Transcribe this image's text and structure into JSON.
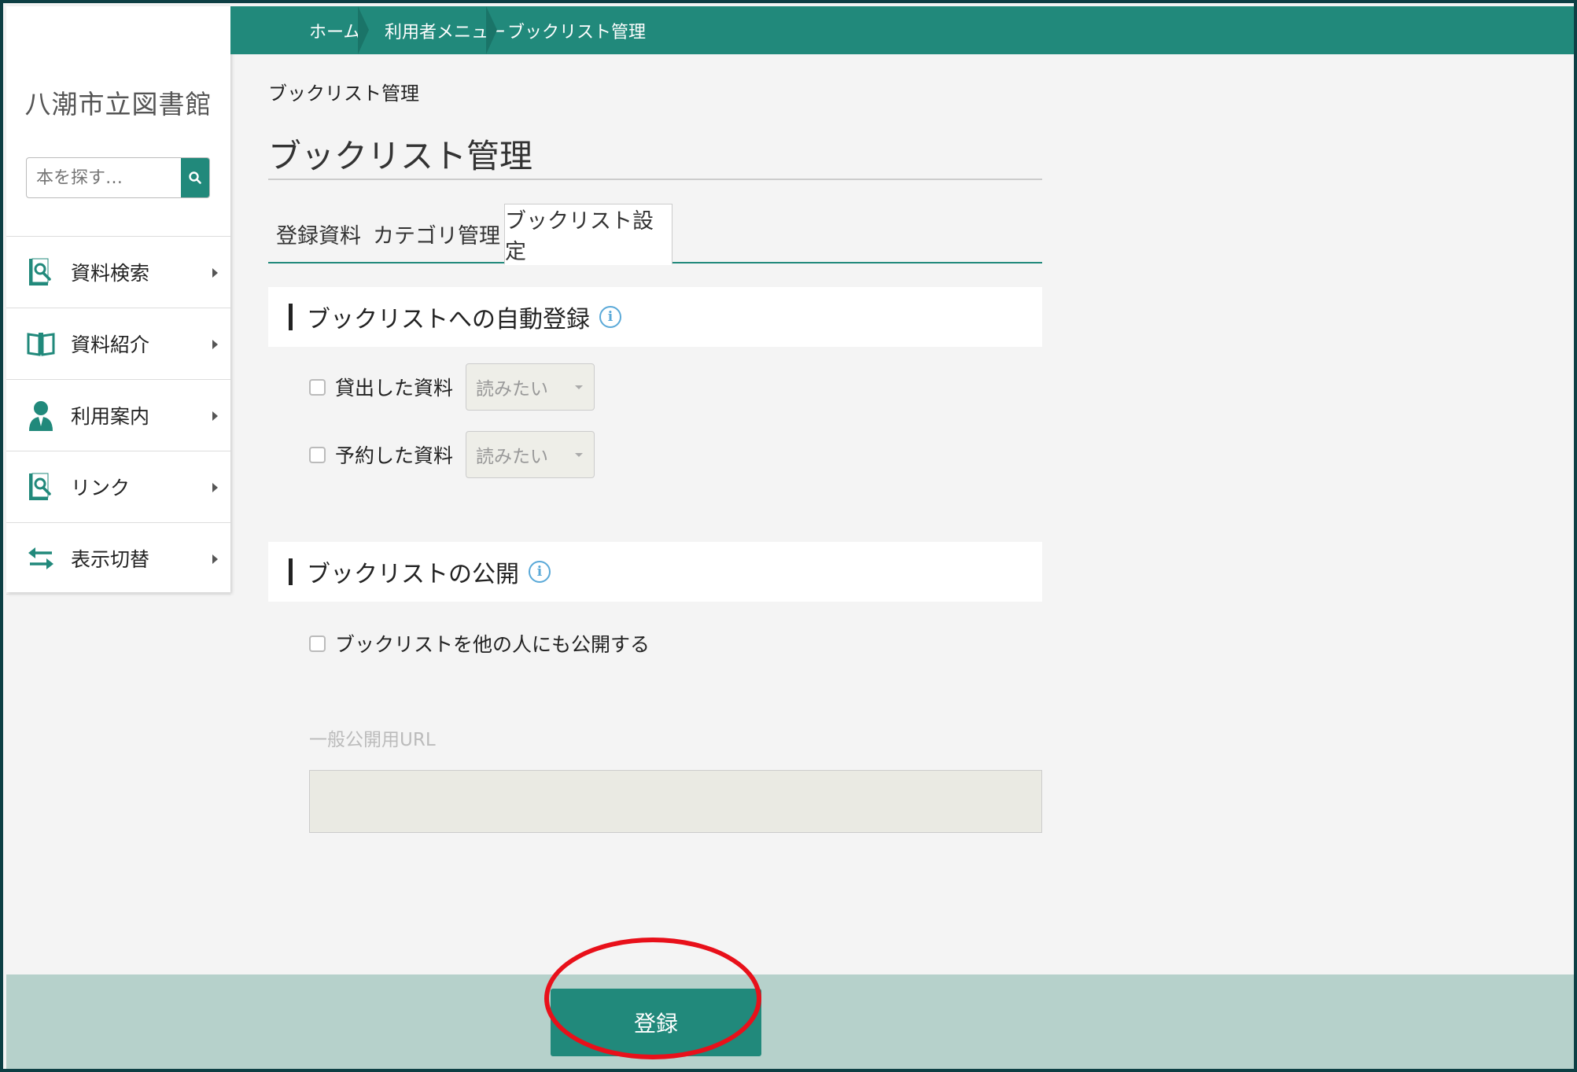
{
  "sidebar": {
    "library_name": "八潮市立図書館",
    "search_placeholder": "本を探す…",
    "items": [
      {
        "label": "資料検索",
        "icon": "book-search-icon"
      },
      {
        "label": "資料紹介",
        "icon": "open-book-icon"
      },
      {
        "label": "利用案内",
        "icon": "person-icon"
      },
      {
        "label": "リンク",
        "icon": "book-search-icon"
      },
      {
        "label": "表示切替",
        "icon": "swap-arrows-icon"
      }
    ]
  },
  "breadcrumb": [
    "ホーム",
    "利用者メニュー",
    "ブックリスト管理"
  ],
  "page": {
    "small_title": "ブックリスト管理",
    "title": "ブックリスト管理"
  },
  "tabs": [
    {
      "label": "登録資料",
      "active": false
    },
    {
      "label": "カテゴリ管理",
      "active": false
    },
    {
      "label": "ブックリスト設定",
      "active": true
    }
  ],
  "auto_register": {
    "title": "ブックリストへの自動登録",
    "rows": [
      {
        "label": "貸出した資料",
        "checked": false,
        "select_value": "読みたい"
      },
      {
        "label": "予約した資料",
        "checked": false,
        "select_value": "読みたい"
      }
    ]
  },
  "publish": {
    "title": "ブックリストの公開",
    "checkbox_label": "ブックリストを他の人にも公開する",
    "checked": false,
    "url_label": "一般公開用URL",
    "url_value": ""
  },
  "footer": {
    "submit_label": "登録"
  },
  "colors": {
    "accent": "#21897b",
    "footer_bg": "#b6d1cb",
    "highlight": "#e8101a"
  }
}
